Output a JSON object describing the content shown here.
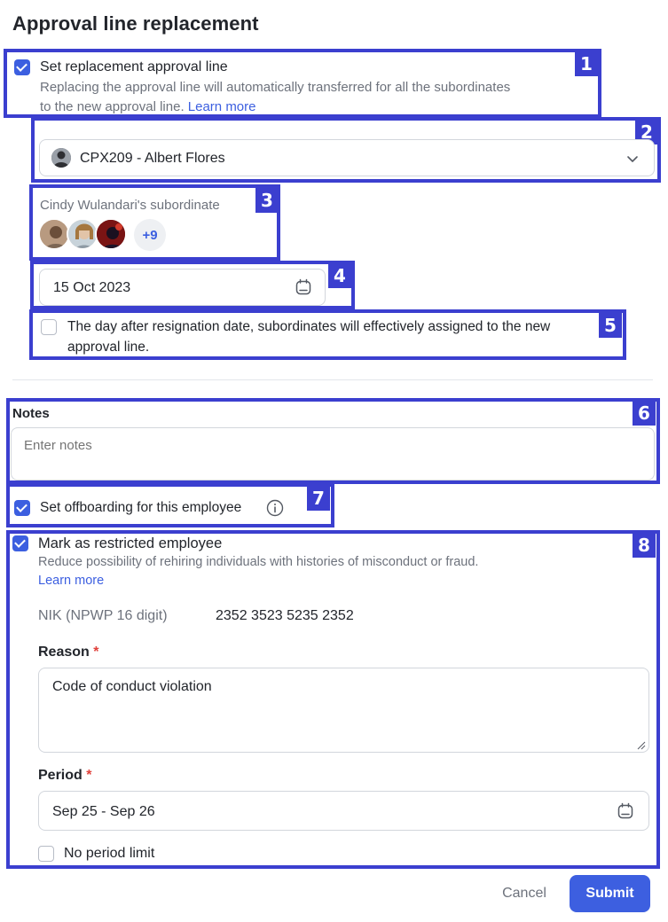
{
  "page_title": "Approval line replacement",
  "replacement": {
    "checkbox_label": "Set replacement approval line",
    "checked": true,
    "description": "Replacing the approval line will automatically transferred for all the subordinates",
    "description_line2": "to the new approval line.",
    "learn_more": "Learn more"
  },
  "approver_select": {
    "value": "CPX209 - Albert Flores",
    "icon": "chevron-down-icon"
  },
  "subordinates": {
    "label": "Cindy Wulandari's subordinate",
    "more_count": "+9"
  },
  "effective_date": {
    "value": "15 Oct 2023",
    "icon": "calendar-icon"
  },
  "day_after": {
    "checked": false,
    "label_line1": "The day after resignation date, subordinates will effectively assigned to the new",
    "label_line2": "approval line."
  },
  "notes": {
    "label": "Notes",
    "placeholder": "Enter notes"
  },
  "offboarding": {
    "label": "Set offboarding for this employee",
    "checked": true,
    "icon": "info-icon"
  },
  "restricted": {
    "label": "Mark as restricted employee",
    "checked": true,
    "description": "Reduce possibility of rehiring individuals with histories of misconduct or fraud.",
    "learn_more": "Learn more",
    "nik_label": "NIK (NPWP 16 digit)",
    "nik_value": "2352 3523 5235 2352",
    "reason_label": "Reason",
    "reason_value": "Code of conduct violation",
    "period_label": "Period",
    "period_value": "Sep 25 - Sep 26",
    "required_mark": "*",
    "no_period_label": "No period limit",
    "no_period_checked": false
  },
  "actions": {
    "cancel": "Cancel",
    "submit": "Submit"
  },
  "annotations": [
    "1",
    "2",
    "3",
    "4",
    "5",
    "6",
    "7",
    "8"
  ],
  "colors": {
    "accent": "#3c5fe0",
    "highlight": "#3b3fcf",
    "required": "#e0413b"
  }
}
